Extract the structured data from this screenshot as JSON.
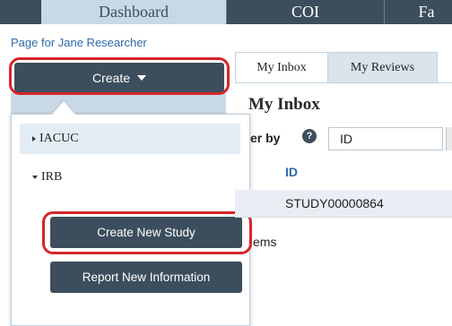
{
  "topnav": {
    "tabs": [
      {
        "label": "Dashboard"
      },
      {
        "label": "COI"
      },
      {
        "label": "Fa"
      }
    ]
  },
  "page_for": "Page for Jane Researcher",
  "create_menu": {
    "button_label": "Create",
    "items": [
      {
        "label": "IACUC",
        "expanded": false
      },
      {
        "label": "IRB",
        "expanded": true
      }
    ],
    "actions": {
      "create_new_study": "Create New Study",
      "report_new_information": "Report New Information"
    }
  },
  "inbox": {
    "tabs": [
      {
        "label": "My Inbox"
      },
      {
        "label": "My Reviews"
      }
    ],
    "title": "My Inbox",
    "filter_label": "er by",
    "filter_value": "ID",
    "column_header": "ID",
    "rows": [
      {
        "id": "STUDY00000864"
      }
    ],
    "items_text": "ems"
  },
  "colors": {
    "nav_dark": "#3c4e5d",
    "nav_light": "#c7d8e6",
    "highlight_ring": "#d6262b",
    "link": "#2d6aa8"
  }
}
